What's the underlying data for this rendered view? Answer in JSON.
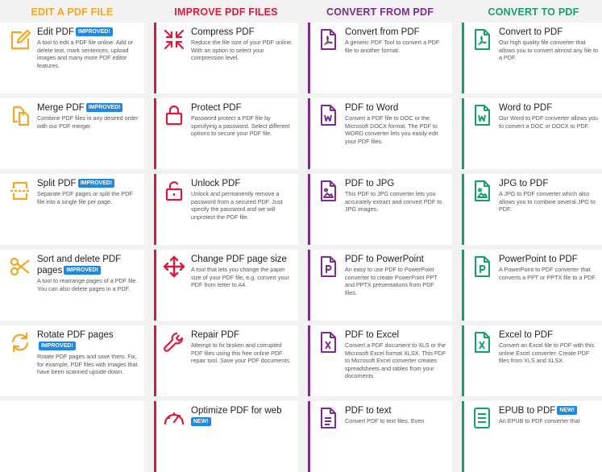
{
  "columns": [
    {
      "header": "EDIT A PDF FILE",
      "color": "#f5a623",
      "tools": [
        {
          "title": "Edit PDF",
          "badge": "IMPROVED!",
          "icon": "edit-icon",
          "desc": "A tool to edit a PDF file online. Add or delete text, mark sentences, upload images and many more PDF editor features."
        },
        {
          "title": "Merge PDF",
          "badge": "IMPROVED!",
          "icon": "merge-icon",
          "desc": "Combine PDF files in any desired order with our PDF merger."
        },
        {
          "title": "Split PDF",
          "badge": "IMPROVED!",
          "icon": "split-icon",
          "desc": "Separate PDF pages or split the PDF file into a single file per page."
        },
        {
          "title": "Sort and delete PDF pages",
          "badge": "IMPROVED!",
          "icon": "scissors-icon",
          "desc": "A tool to rearrange pages of a PDF file. You can also delete pages in a PDF."
        },
        {
          "title": "Rotate PDF pages",
          "badge": "IMPROVED!",
          "icon": "rotate-icon",
          "desc": "Rotate PDF pages and save them. Fix, for example, PDF files with images that have been scanned upside down."
        }
      ]
    },
    {
      "header": "IMPROVE PDF FILES",
      "color": "#d81b3c",
      "tools": [
        {
          "title": "Compress PDF",
          "badge": "",
          "icon": "compress-icon",
          "desc": "Reduce the file size of your PDF online. With an option to select your compression level."
        },
        {
          "title": "Protect PDF",
          "badge": "",
          "icon": "lock-icon",
          "desc": "Password protect a PDF file by specifying a password. Select different options to secure your PDF file."
        },
        {
          "title": "Unlock PDF",
          "badge": "",
          "icon": "unlock-icon",
          "desc": "Unlock and permanently remove a password from a secured PDF. Just specify the password and we will unprotect the PDF file."
        },
        {
          "title": "Change PDF page size",
          "badge": "",
          "icon": "move-arrows-icon",
          "desc": "A tool that lets you change the paper size of your PDF file, e.g. convert your PDF from letter to A4."
        },
        {
          "title": "Repair PDF",
          "badge": "",
          "icon": "wrench-icon",
          "desc": "Attempt to fix broken and corrupted PDF files using this free online PDF repair tool. Save your PDF documents."
        },
        {
          "title": "Optimize PDF for web",
          "badge": "NEW!",
          "icon": "gauge-icon",
          "desc": ""
        }
      ]
    },
    {
      "header": "CONVERT FROM PDF",
      "color": "#7b2d8b",
      "tools": [
        {
          "title": "Convert from PDF",
          "badge": "",
          "icon": "pdf-file-icon",
          "desc": "A generic PDF Tool to convert a PDF file to another format."
        },
        {
          "title": "PDF to Word",
          "badge": "",
          "icon": "word-file-icon",
          "desc": "Convert a PDF file to DOC or the Microsoft DOCX format. The PDF to WORD converter lets you easily edit your PDF files."
        },
        {
          "title": "PDF to JPG",
          "badge": "",
          "icon": "image-file-icon",
          "desc": "This PDF to JPG converter lets you accurately extract and convert PDF to JPG images."
        },
        {
          "title": "PDF to PowerPoint",
          "badge": "",
          "icon": "powerpoint-file-icon",
          "desc": "An easy to use PDF to PowerPoint converter to create PowerPoint PPT and PPTX presentations from PDF files."
        },
        {
          "title": "PDF to Excel",
          "badge": "",
          "icon": "excel-file-icon",
          "desc": "Convert a PDF document to XLS or the Microsoft Excel format XLSX. This PDF to Microsoft Excel converter creates spreadsheets and tables from your documents."
        },
        {
          "title": "PDF to text",
          "badge": "",
          "icon": "text-file-icon",
          "desc": "Convert PDF to text files. Even"
        }
      ]
    },
    {
      "header": "CONVERT TO PDF",
      "color": "#15a06a",
      "tools": [
        {
          "title": "Convert to PDF",
          "badge": "",
          "icon": "pdf-file-icon",
          "desc": "Our high quality file converter that allows you to convert almost any file to a PDF."
        },
        {
          "title": "Word to PDF",
          "badge": "",
          "icon": "word-file-icon",
          "desc": "Our Word to PDF converter allows you to convert a DOC or DOCX to PDF."
        },
        {
          "title": "JPG to PDF",
          "badge": "",
          "icon": "image-file-icon",
          "desc": "A JPG to PDF converter which also allows you to combine several JPG to PDF."
        },
        {
          "title": "PowerPoint to PDF",
          "badge": "",
          "icon": "powerpoint-file-icon",
          "desc": "A PowerPoint to PDF converter that converts a PPT or PPTX file to a PDF."
        },
        {
          "title": "Excel to PDF",
          "badge": "",
          "icon": "excel-file-icon",
          "desc": "Convert an Excel file to PDF with this online Excel converter. Create PDF files from XLS and XLSX."
        },
        {
          "title": "EPUB to PDF",
          "badge": "NEW!",
          "icon": "epub-file-icon",
          "desc": "An EPUB to PDF converter that"
        }
      ]
    }
  ]
}
